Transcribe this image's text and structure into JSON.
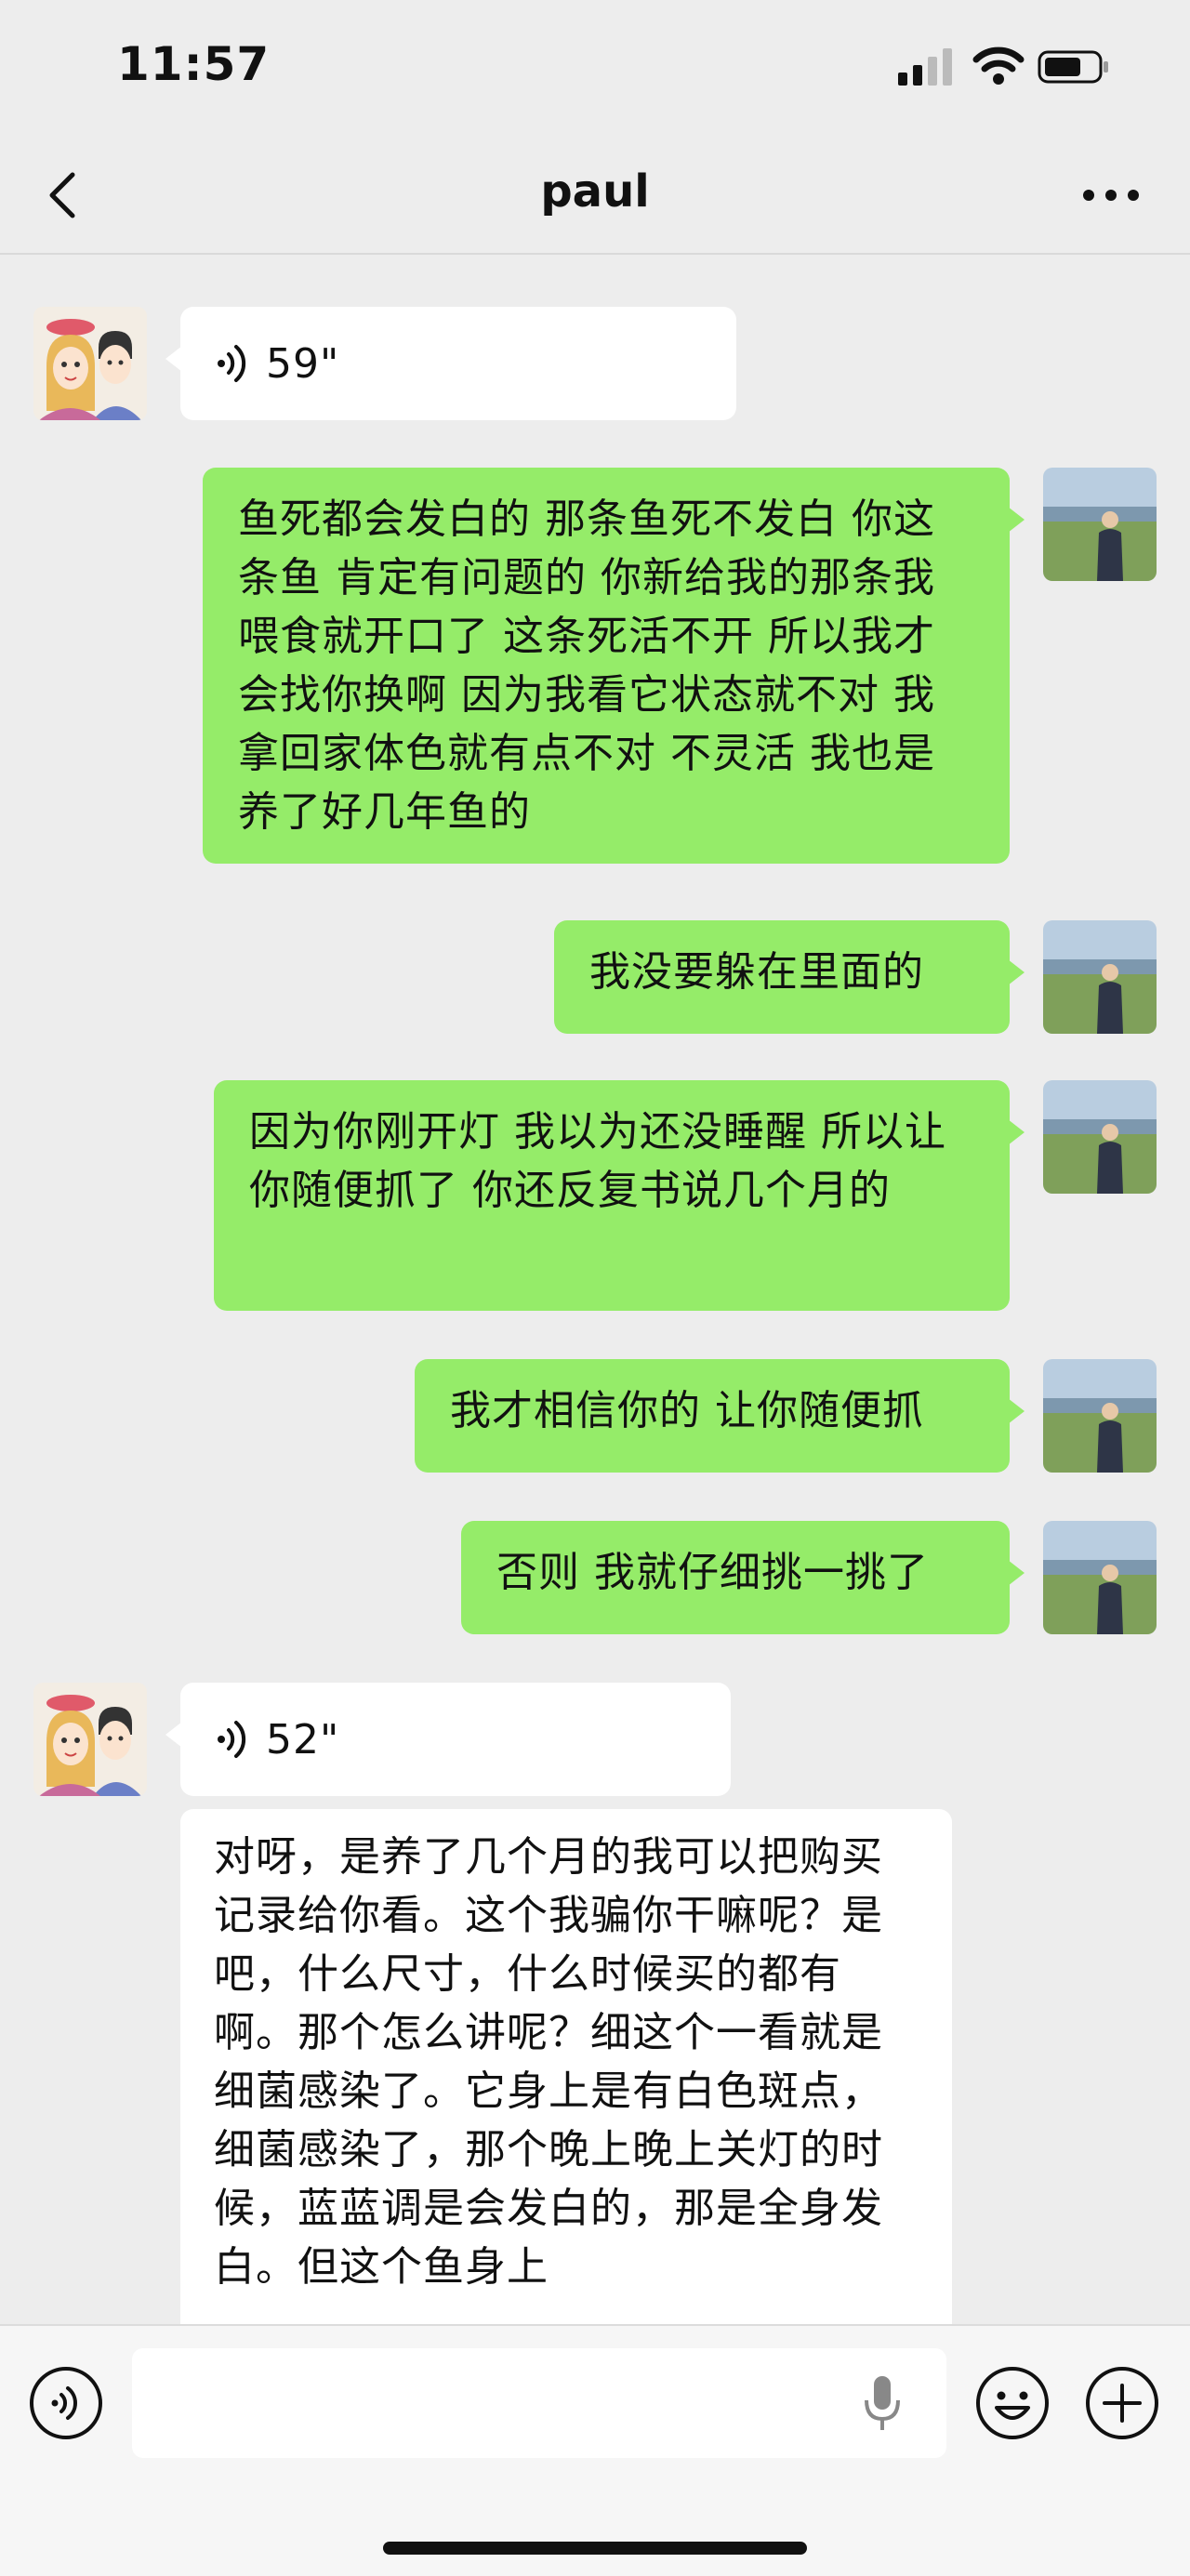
{
  "status_bar": {
    "time": "11:57"
  },
  "header": {
    "title": "paul"
  },
  "messages": [
    {
      "sender": "other",
      "type": "voice",
      "duration": "59\""
    },
    {
      "sender": "me",
      "type": "text",
      "text": "鱼死都会发白的 那条鱼死不发白 你这条鱼 肯定有问题的 你新给我的那条我喂食就开口了 这条死活不开 所以我才会找你换啊 因为我看它状态就不对 我拿回家体色就有点不对 不灵活 我也是养了好几年鱼的"
    },
    {
      "sender": "me",
      "type": "text",
      "text": "我没要躲在里面的"
    },
    {
      "sender": "me",
      "type": "text",
      "text": "因为你刚开灯 我以为还没睡醒 所以让你随便抓了 你还反复书说几个月的"
    },
    {
      "sender": "me",
      "type": "text",
      "text": "我才相信你的 让你随便抓"
    },
    {
      "sender": "me",
      "type": "text",
      "text": "否则 我就仔细挑一挑了"
    },
    {
      "sender": "other",
      "type": "voice",
      "duration": "52\""
    },
    {
      "sender": "other",
      "type": "text",
      "text": "对呀，是养了几个月的我可以把购买记录给你看。这个我骗你干嘛呢？是吧，什么尺寸，什么时候买的都有啊。那个怎么讲呢？细这个一看就是细菌感染了。它身上是有白色斑点，细菌感染了，那个晚上晚上关灯的时候，蓝蓝调是会发白的，那是全身发白。但这个鱼身上"
    }
  ],
  "input_bar": {
    "value": ""
  },
  "icons": {
    "voice_toggle": "voice-mode-icon",
    "mic": "microphone-icon",
    "emoji": "emoji-icon",
    "add": "plus-icon"
  },
  "colors": {
    "my_bubble": "#95ec69",
    "other_bubble": "#ffffff",
    "chat_background": "#ededed"
  }
}
